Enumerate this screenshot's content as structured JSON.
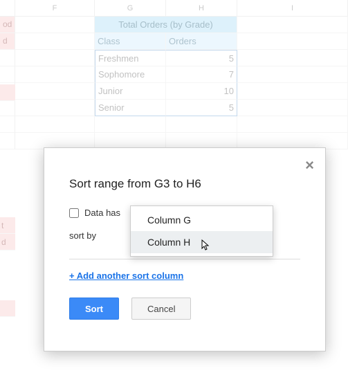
{
  "cols": {
    "F": "F",
    "G": "G",
    "H": "H",
    "I": "I"
  },
  "pink_stub": {
    "top": "od",
    "r2": "d"
  },
  "merged_title": "Total Orders (by Grade)",
  "table_headers": {
    "class": "Class",
    "orders": "Orders"
  },
  "rows": [
    {
      "class": "Freshmen",
      "orders": "5"
    },
    {
      "class": "Sophomore",
      "orders": "7"
    },
    {
      "class": "Junior",
      "orders": "10"
    },
    {
      "class": "Senior",
      "orders": "5"
    }
  ],
  "dialog": {
    "title": "Sort range from G3 to H6",
    "checkbox_label": "Data has",
    "sort_by_label": "sort by",
    "add_link": "+ Add another sort column",
    "sort_btn": "Sort",
    "cancel_btn": "Cancel"
  },
  "dropdown": {
    "items": [
      "Column G",
      "Column H"
    ]
  },
  "side_pink": {
    "t": "t",
    "d": "d"
  }
}
